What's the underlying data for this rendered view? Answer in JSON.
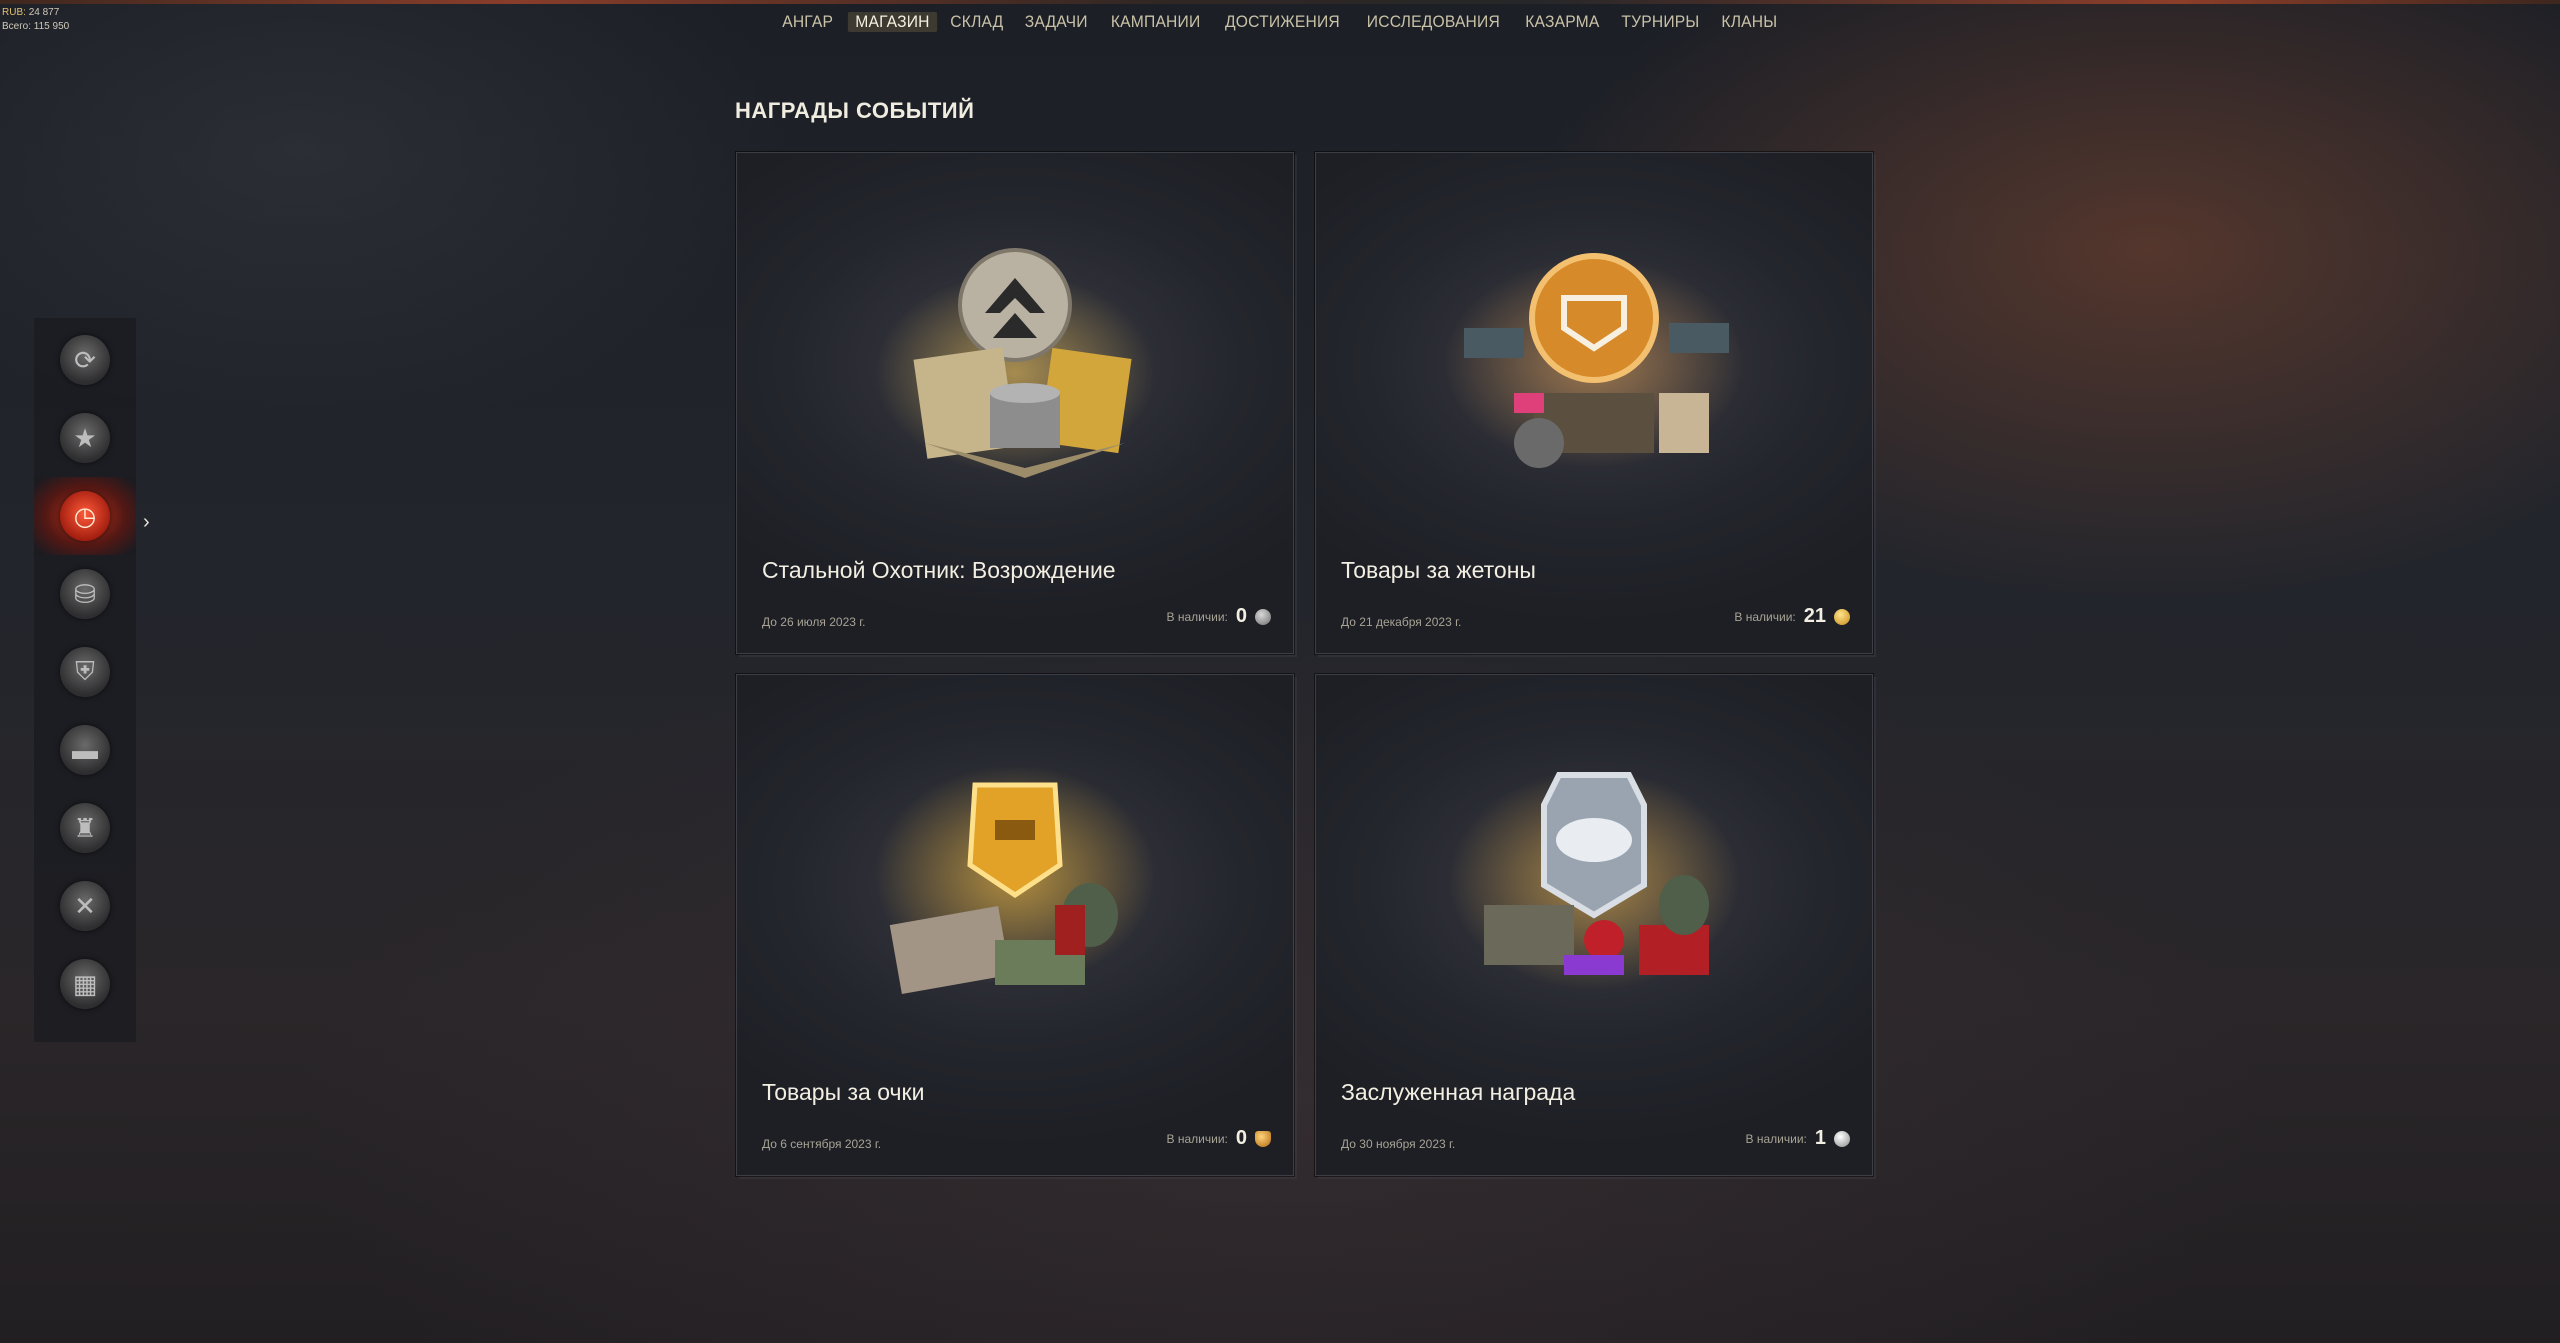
{
  "account": {
    "line1_label": "RUB:",
    "line1_value": "24 877",
    "line2_label": "Всего:",
    "line2_value": "115 950"
  },
  "nav": {
    "items": [
      "АНГАР",
      "МАГАЗИН",
      "СКЛАД",
      "ЗАДАЧИ",
      "КАМПАНИИ",
      "ДОСТИЖЕНИЯ",
      "ИССЛЕДОВАНИЯ",
      "КАЗАРМА",
      "ТУРНИРЫ",
      "КЛАНЫ"
    ],
    "active": "МАГАЗИН"
  },
  "page": {
    "title": "НАГРАДЫ СОБЫТИЙ"
  },
  "sidebar": {
    "icons": [
      "refresh-wreath-icon",
      "star-icon",
      "clock-icon",
      "coins-icon",
      "shield-icon",
      "tank-icon",
      "equipment-icon",
      "tools-icon",
      "money-icon"
    ],
    "active_index": 2
  },
  "cards": [
    {
      "title": "Стальной Охотник: Возрождение",
      "date": "До 26 июля 2023 г.",
      "stock_label": "В наличии:",
      "stock_value": "0",
      "currency_icon": "steel-hunter-token-icon"
    },
    {
      "title": "Товары за жетоны",
      "date": "До 21 декабря 2023 г.",
      "stock_label": "В наличии:",
      "stock_value": "21",
      "currency_icon": "gold-token-icon"
    },
    {
      "title": "Товары за очки",
      "date": "До 6 сентября 2023 г.",
      "stock_label": "В наличии:",
      "stock_value": "0",
      "currency_icon": "shield-points-icon"
    },
    {
      "title": "Заслуженная награда",
      "date": "До 30 ноября 2023 г.",
      "stock_label": "В наличии:",
      "stock_value": "1",
      "currency_icon": "reward-token-icon"
    }
  ],
  "colors": {
    "accent_active": "#e63c1e",
    "gold": "#e0b040",
    "text_primary": "#f2eee2",
    "text_muted": "#a8a394"
  }
}
